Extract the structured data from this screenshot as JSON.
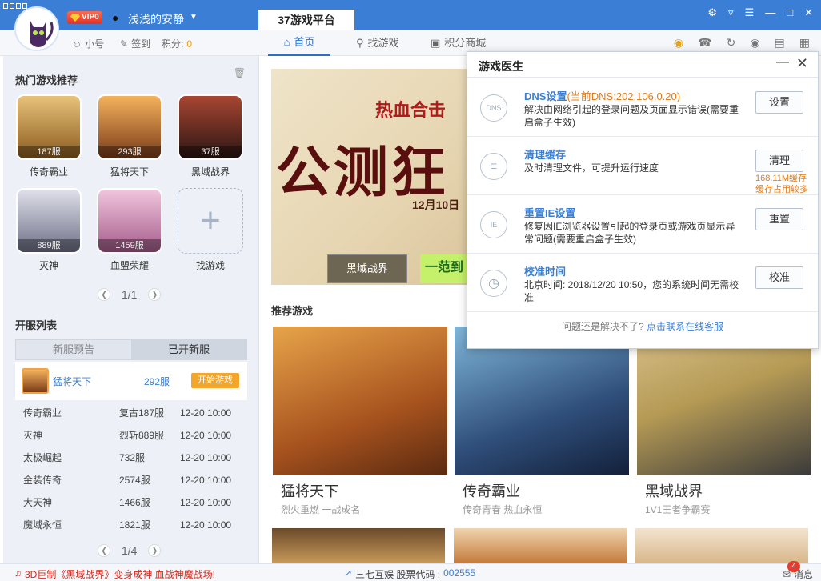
{
  "header": {
    "vip_label": "VIP0",
    "username": "浅浅的安静",
    "platform_tab": "37游戏平台"
  },
  "subbar": {
    "alt_account": "小号",
    "checkin": "签到",
    "points_label": "积分:",
    "points_value": "0",
    "nav": [
      "首页",
      "找游戏",
      "积分商城"
    ]
  },
  "sidebar": {
    "hot_title": "热门游戏推荐",
    "games": [
      {
        "name": "传奇霸业",
        "server": "187服",
        "color": "#b8862f"
      },
      {
        "name": "猛将天下",
        "server": "293服",
        "color": "#c9672a"
      },
      {
        "name": "黑域战界",
        "server": "37服",
        "color": "#7a2b22"
      },
      {
        "name": "灭神",
        "server": "889服",
        "color": "#8d8fa6"
      },
      {
        "name": "血盟荣耀",
        "server": "1459服",
        "color": "#c98ab0"
      }
    ],
    "find_game": "找游戏",
    "pager1": "1/1",
    "server_title": "开服列表",
    "server_tabs": [
      "新服预告",
      "已开新服"
    ],
    "highlight": {
      "name": "猛将天下",
      "server": "292服",
      "button": "开始游戏"
    },
    "servers": [
      {
        "game": "传奇霸业",
        "server": "复古187服",
        "time": "12-20 10:00"
      },
      {
        "game": "灭神",
        "server": "烈斩889服",
        "time": "12-20 10:00"
      },
      {
        "game": "太极崛起",
        "server": "732服",
        "time": "12-20 10:00"
      },
      {
        "game": "金装传奇",
        "server": "2574服",
        "time": "12-20 10:00"
      },
      {
        "game": "大天神",
        "server": "1466服",
        "time": "12-20 10:00"
      },
      {
        "game": "魔域永恒",
        "server": "1821服",
        "time": "12-20 10:00"
      }
    ],
    "pager2": "1/4"
  },
  "main": {
    "banner": {
      "logo": "热血合击",
      "headline": "公测狂",
      "date": "12月10日",
      "thumb1": "黑域战界",
      "thumb2": "一范到"
    },
    "rec_title": "推荐游戏",
    "cards": [
      {
        "name": "猛将天下",
        "desc": "烈火重燃 一战成名",
        "color1": "#a8531e",
        "color2": "#e7a44a"
      },
      {
        "name": "传奇霸业",
        "desc": "传奇青春 热血永恒",
        "color1": "#2f4e7a",
        "color2": "#7fb6d8"
      },
      {
        "name": "黑域战界",
        "desc": "1V1王者争霸赛",
        "color1": "#3a3a3a",
        "color2": "#b59a55"
      }
    ]
  },
  "doctor": {
    "title": "游戏医生",
    "items": [
      {
        "name": "DNS设置",
        "extra": "(当前DNS:202.106.0.20)",
        "desc": "解决由网络引起的登录问题及页面显示错误(需要重启盒子生效)",
        "button": "设置",
        "note": ""
      },
      {
        "name": "清理缓存",
        "extra": "",
        "desc": "及时清理文件，可提升运行速度",
        "button": "清理",
        "note": "168.11M缓存\n缓存占用较多"
      },
      {
        "name": "重置IE设置",
        "extra": "",
        "desc": "修复因IE浏览器设置引起的登录页或游戏页显示异常问题(需要重启盒子生效)",
        "button": "重置",
        "note": ""
      },
      {
        "name": "校准时间",
        "extra": "",
        "desc": "北京时间: 2018/12/20 10:50，您的系统时间无需校准",
        "button": "校准",
        "note": ""
      }
    ],
    "icons": [
      "DNS",
      "",
      "IE",
      ""
    ],
    "footer_text": "问题还是解决不了?",
    "footer_link": "点击联系在线客服"
  },
  "status": {
    "ticker": "3D巨制《黑域战界》变身成神 血战神魔战场!",
    "company": "三七互娱 股票代码 :",
    "stock_code": "002555",
    "messages": "消息",
    "badge": "4"
  }
}
